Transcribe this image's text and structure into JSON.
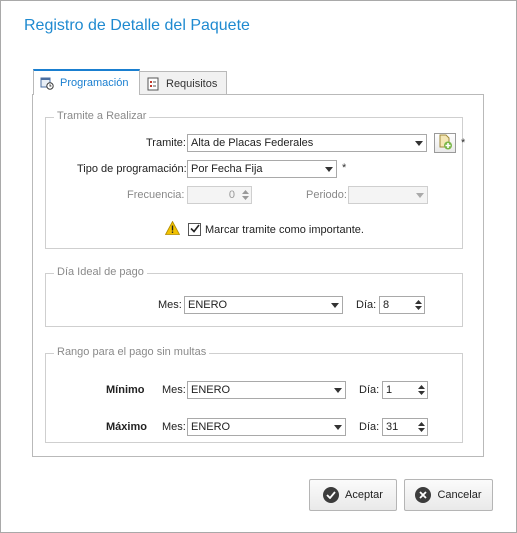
{
  "window": {
    "title": "Registro de Detalle del Paquete"
  },
  "tabs": [
    {
      "label": "Programación",
      "icon": "schedule-icon",
      "active": true
    },
    {
      "label": "Requisitos",
      "icon": "checklist-icon",
      "active": false
    }
  ],
  "tramite_group": {
    "title": "Tramite a Realizar",
    "tramite_label": "Tramite:",
    "tramite_value": "Alta de Placas Federales",
    "tramite_required": "*",
    "tipo_label": "Tipo de programación:",
    "tipo_value": "Por Fecha Fija",
    "tipo_required": "*",
    "frecuencia_label": "Frecuencia:",
    "frecuencia_value": "0",
    "periodo_label": "Periodo:",
    "periodo_value": "",
    "importante_label": "Marcar tramite como importante.",
    "importante_checked": true
  },
  "dia_ideal_group": {
    "title": "Día Ideal de pago",
    "mes_label": "Mes:",
    "mes_value": "ENERO",
    "dia_label": "Día:",
    "dia_value": "8"
  },
  "rango_group": {
    "title": "Rango para el pago sin multas",
    "minimo_label": "Mínimo",
    "minimo_mes_label": "Mes:",
    "minimo_mes_value": "ENERO",
    "minimo_dia_label": "Día:",
    "minimo_dia_value": "1",
    "maximo_label": "Máximo",
    "maximo_mes_label": "Mes:",
    "maximo_mes_value": "ENERO",
    "maximo_dia_label": "Día:",
    "maximo_dia_value": "31"
  },
  "buttons": {
    "accept_label": "Aceptar",
    "cancel_label": "Cancelar"
  },
  "colors": {
    "title": "#1f8ad0",
    "tab_active": "#1a7fd0",
    "warning": "#f2c200"
  }
}
